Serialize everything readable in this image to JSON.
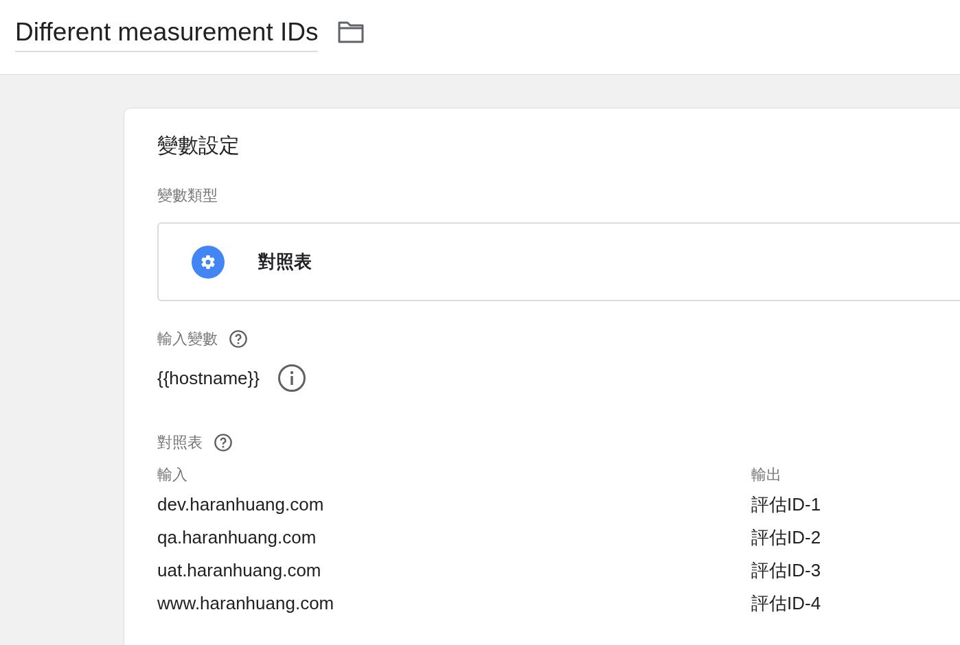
{
  "header": {
    "title": "Different measurement IDs"
  },
  "card": {
    "title": "變數設定",
    "variable_type": {
      "label": "變數類型",
      "value": "對照表"
    },
    "input_variable": {
      "label": "輸入變數",
      "value": "{{hostname}}"
    },
    "lookup_table": {
      "label": "對照表",
      "columns": [
        "輸入",
        "輸出"
      ],
      "rows": [
        [
          "dev.haranhuang.com",
          "評估ID-1"
        ],
        [
          "qa.haranhuang.com",
          "評估ID-2"
        ],
        [
          "uat.haranhuang.com",
          "評估ID-3"
        ],
        [
          "www.haranhuang.com",
          "評估ID-4"
        ]
      ]
    }
  }
}
